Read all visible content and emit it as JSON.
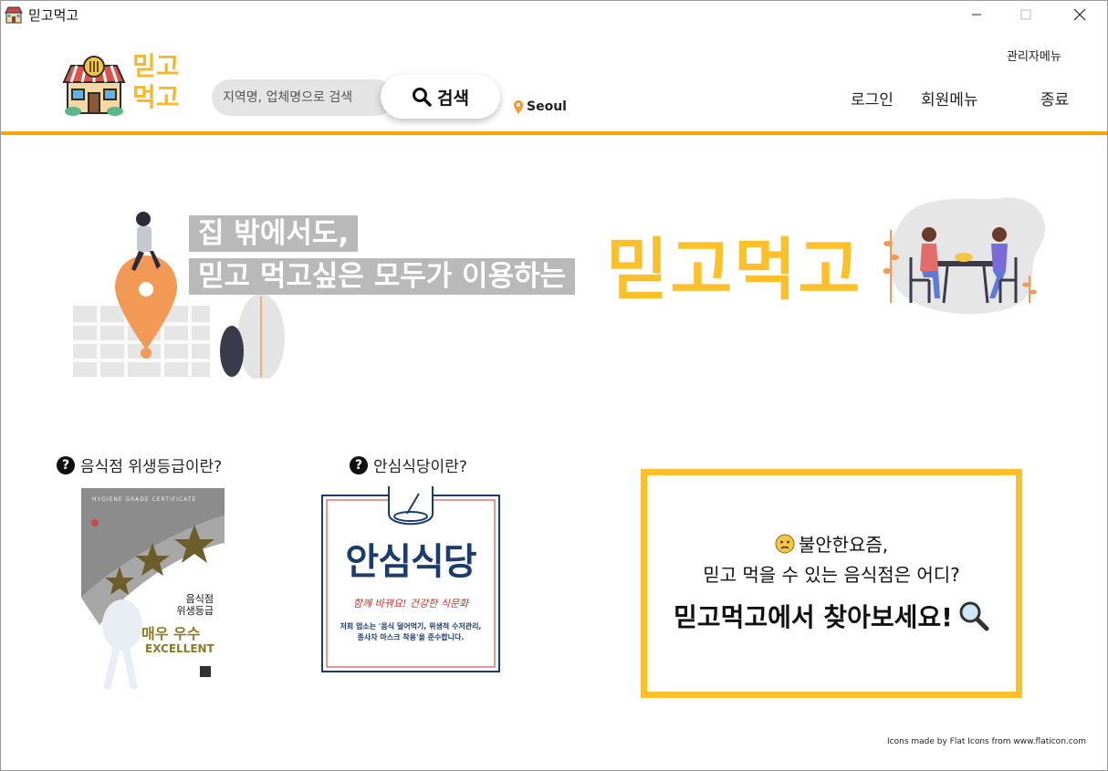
{
  "window": {
    "title": "믿고먹고"
  },
  "header": {
    "logo_line1": "믿고",
    "logo_line2": "먹고",
    "search_placeholder": "지역명, 업체명으로 검색",
    "search_button": "검색",
    "location": "Seoul",
    "admin_menu": "관리자메뉴",
    "nav": {
      "login": "로그인",
      "member_menu": "회원메뉴",
      "exit": "종료"
    }
  },
  "banner": {
    "line1": "집 밖에서도,",
    "line2": "믿고 먹고싶은 모두가 이용하는",
    "title": "믿고먹고"
  },
  "info": {
    "hygiene_question": "음식점 위생등급이란?",
    "safe_question": "안심식당이란?",
    "hygiene_card": {
      "header": "HYGIENE GRADE CERTIFICATE",
      "line1": "음식점",
      "line2": "위생등급",
      "grade": "매우 우수",
      "grade_en": "EXCELLENT"
    },
    "safe_card": {
      "title": "안심식당",
      "slogan": "함께 바꿔요! 건강한 식문화",
      "desc1": "저희 업소는 '음식 덜어먹기, 위생적 수저관리,",
      "desc2": "종사자 마스크 착용'을 준수합니다."
    }
  },
  "promo": {
    "line1": "불안한요즘,",
    "line2": "믿고 먹을 수 있는 음식점은 어디?",
    "line3": "믿고먹고에서 찾아보세요!"
  },
  "footer": {
    "credit": "Icons made by Flat Icons from www.flaticon.com"
  },
  "colors": {
    "accent": "#f9a500",
    "brand_yellow": "#fcc12a",
    "banner_gray": "#b9b9b9",
    "safe_navy": "#1d3c6e",
    "safe_red": "#c8322f"
  }
}
